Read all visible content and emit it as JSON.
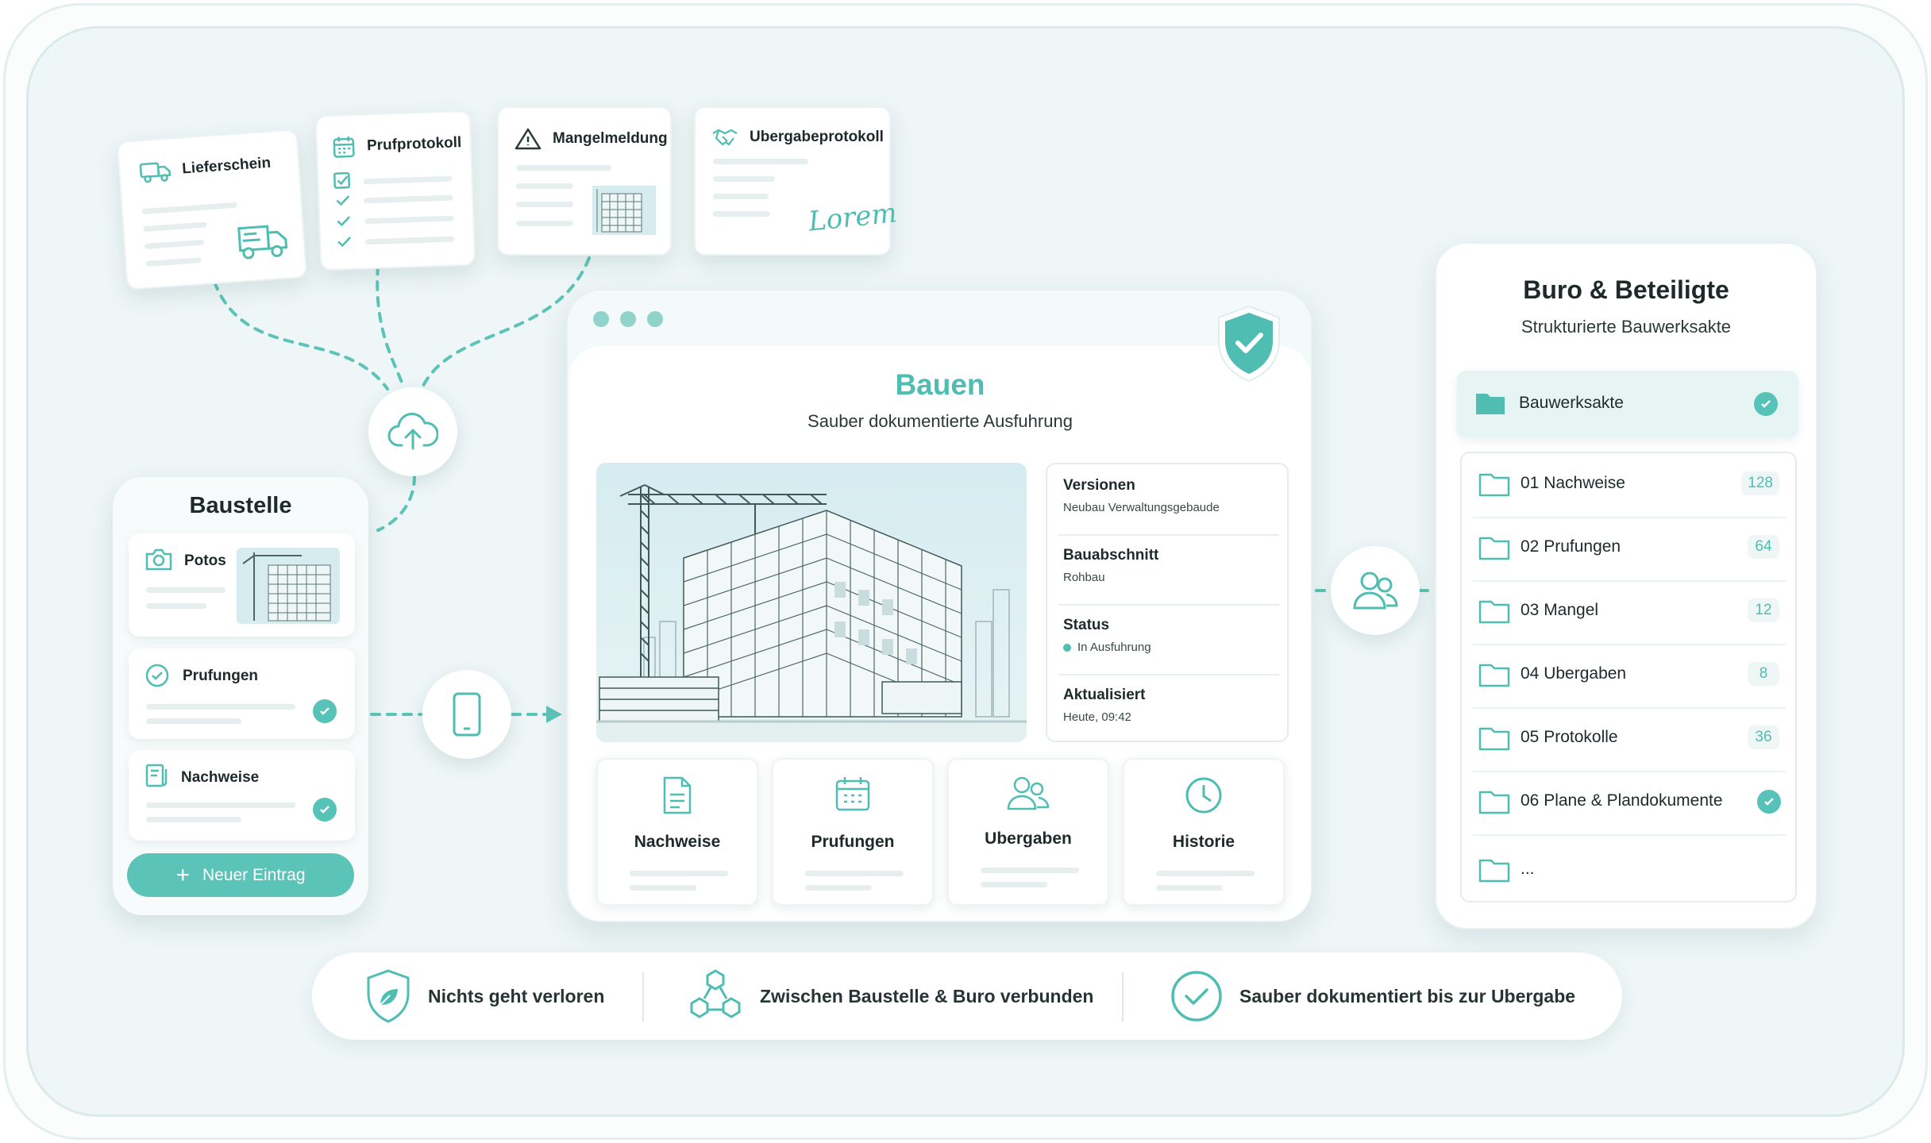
{
  "documents": [
    {
      "label": "Lieferschein",
      "icon": "truck-icon"
    },
    {
      "label": "Prufprotokoll",
      "icon": "calendar-icon"
    },
    {
      "label": "Mangelmeldung",
      "icon": "warning-icon"
    },
    {
      "label": "Ubergabeprotokoll",
      "icon": "handshake-icon"
    }
  ],
  "signature": "Lorem",
  "baustelle": {
    "title": "Baustelle",
    "items": [
      {
        "label": "Potos",
        "icon": "camera-icon"
      },
      {
        "label": "Prufungen",
        "icon": "check-circle-icon"
      },
      {
        "label": "Nachweise",
        "icon": "document-icon"
      }
    ],
    "button": "Neuer Eintrag"
  },
  "main": {
    "title": "Bauen",
    "subtitle": "Sauber dokumentierte Ausfuhrung",
    "info": [
      {
        "key": "Versionen",
        "value": "Neubau Verwaltungsgebaude"
      },
      {
        "key": "Bauabschnitt",
        "value": "Rohbau"
      },
      {
        "key": "Status",
        "value": "In Ausfuhrung"
      },
      {
        "key": "Aktualisiert",
        "value": "Heute, 09:42"
      }
    ],
    "tiles": [
      {
        "label": "Nachweise",
        "icon": "file-icon"
      },
      {
        "label": "Prufungen",
        "icon": "calendar-icon"
      },
      {
        "label": "Ubergaben",
        "icon": "users-icon"
      },
      {
        "label": "Historie",
        "icon": "clock-icon"
      }
    ]
  },
  "buro": {
    "title": "Buro & Beteiligte",
    "subtitle": "Strukturierte Bauwerksakte",
    "akte": "Bauwerksakte",
    "folders": [
      {
        "label": "01 Nachweise",
        "count": "128"
      },
      {
        "label": "02 Prufungen",
        "count": "64"
      },
      {
        "label": "03 Mangel",
        "count": "12"
      },
      {
        "label": "04 Ubergaben",
        "count": "8"
      },
      {
        "label": "05 Protokolle",
        "count": "36"
      },
      {
        "label": "06 Plane & Plandokumente",
        "count": null
      },
      {
        "label": "...",
        "count": null
      }
    ]
  },
  "benefits": [
    {
      "label": "Nichts geht verloren",
      "icon": "shield-leaf-icon"
    },
    {
      "label": "Zwischen Baustelle & Buro verbunden",
      "icon": "network-icon"
    },
    {
      "label": "Sauber dokumentiert bis zur Ubergabe",
      "icon": "check-circle-icon"
    }
  ],
  "colors": {
    "accent": "#4fbdb2",
    "background": "#eef6f7"
  }
}
